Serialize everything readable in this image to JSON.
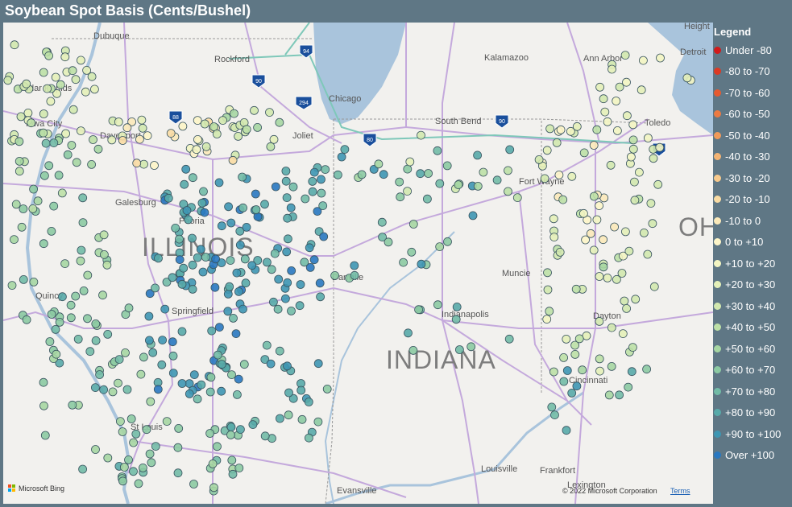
{
  "title": "Soybean Spot Basis (Cents/Bushel)",
  "legend": {
    "title": "Legend",
    "items": [
      {
        "label": "Under -80",
        "color": "#d11b1b"
      },
      {
        "label": "-80 to -70",
        "color": "#dc3a24"
      },
      {
        "label": "-70 to -60",
        "color": "#e55a30"
      },
      {
        "label": "-60 to -50",
        "color": "#ec7a42"
      },
      {
        "label": "-50 to -40",
        "color": "#f19a5a"
      },
      {
        "label": "-40 to -30",
        "color": "#f4b474"
      },
      {
        "label": "-30 to -20",
        "color": "#f7c98c"
      },
      {
        "label": "-20 to -10",
        "color": "#f9dba3"
      },
      {
        "label": "-10 to 0",
        "color": "#fbe9b9"
      },
      {
        "label": "0 to +10",
        "color": "#fdf5c8"
      },
      {
        "label": "+10 to +20",
        "color": "#f3f5c2"
      },
      {
        "label": "+20 to +30",
        "color": "#e4f0b8"
      },
      {
        "label": "+30 to +40",
        "color": "#d2e8ae"
      },
      {
        "label": "+40 to +50",
        "color": "#bde0a6"
      },
      {
        "label": "+50 to +60",
        "color": "#a6d6a2"
      },
      {
        "label": "+60 to +70",
        "color": "#8ccaa2"
      },
      {
        "label": "+70 to +80",
        "color": "#72bba6"
      },
      {
        "label": "+80 to +90",
        "color": "#58aaa9"
      },
      {
        "label": "+90 to +100",
        "color": "#3e96b2"
      },
      {
        "label": "Over +100",
        "color": "#2978c0"
      }
    ]
  },
  "map": {
    "states": [
      "ILLINOIS",
      "INDIANA",
      "OH"
    ],
    "cities": [
      "Dubuque",
      "Rockford",
      "Chicago",
      "Kalamazoo",
      "Ann Arbor",
      "Detroit",
      "Height",
      "Cedar Rapids",
      "Iowa City",
      "Davenport",
      "Joliet",
      "South Bend",
      "Toledo",
      "Galesburg",
      "Peoria",
      "Fort Wayne",
      "Quincy",
      "Springfield",
      "Danville",
      "Muncie",
      "Indianapolis",
      "Dayton",
      "Cincinnati",
      "St Louis",
      "Louisville",
      "Frankfort",
      "Evansville",
      "Lexington"
    ],
    "highways": [
      "94",
      "90",
      "294",
      "88",
      "80",
      "90",
      "90"
    ],
    "copyright": "© 2022 Microsoft Corporation",
    "terms": "Terms",
    "provider": "Microsoft Bing"
  }
}
